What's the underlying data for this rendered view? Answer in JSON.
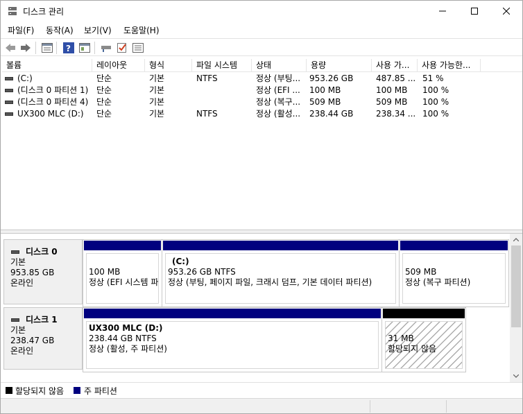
{
  "window": {
    "title": "디스크 관리"
  },
  "menu": [
    "파일(F)",
    "동작(A)",
    "보기(V)",
    "도움말(H)"
  ],
  "toolbar": [
    "back-icon",
    "forward-icon",
    "list-view-icon",
    "help-icon",
    "panel-icon",
    "connect-icon",
    "check-icon",
    "properties-icon"
  ],
  "volume_list": {
    "headers": [
      "볼륨",
      "레이아웃",
      "형식",
      "파일 시스템",
      "상태",
      "용량",
      "사용 가...",
      "사용 가능한..."
    ],
    "rows": [
      [
        "(C:)",
        "단순",
        "기본",
        "NTFS",
        "정상 (부팅...",
        "953.26 GB",
        "487.85 ...",
        "51 %"
      ],
      [
        "(디스크 0 파티션 1)",
        "단순",
        "기본",
        "",
        "정상 (EFI ...",
        "100 MB",
        "100 MB",
        "100 %"
      ],
      [
        "(디스크 0 파티션 4)",
        "단순",
        "기본",
        "",
        "정상 (복구...",
        "509 MB",
        "509 MB",
        "100 %"
      ],
      [
        "UX300 MLC (D:)",
        "단순",
        "기본",
        "NTFS",
        "정상 (활성...",
        "238.44 GB",
        "238.34 ...",
        "100 %"
      ]
    ]
  },
  "disks": [
    {
      "name": "디스크 0",
      "type": "기본",
      "size": "953.85 GB",
      "state": "온라인",
      "partitions": [
        {
          "title": "",
          "line1": "100 MB",
          "line2": "정상 (EFI 시스템 파"
        },
        {
          "title": "(C:)",
          "line1": "953.26 GB NTFS",
          "line2": "정상 (부팅, 페이지 파일, 크래시 덤프, 기본 데이터 파티션)"
        },
        {
          "title": "",
          "line1": "509 MB",
          "line2": "정상 (복구 파티션)"
        }
      ]
    },
    {
      "name": "디스크 1",
      "type": "기본",
      "size": "238.47 GB",
      "state": "온라인",
      "partitions": [
        {
          "title": "UX300 MLC  (D:)",
          "line1": "238.44 GB NTFS",
          "line2": "정상 (활성, 주 파티션)"
        },
        {
          "title": "",
          "line1": "31 MB",
          "line2": "할당되지 않음"
        }
      ]
    }
  ],
  "legend": {
    "unallocated": "할당되지 않음",
    "primary": "주 파티션",
    "unallocated_color": "#000000",
    "primary_color": "#00007f"
  }
}
